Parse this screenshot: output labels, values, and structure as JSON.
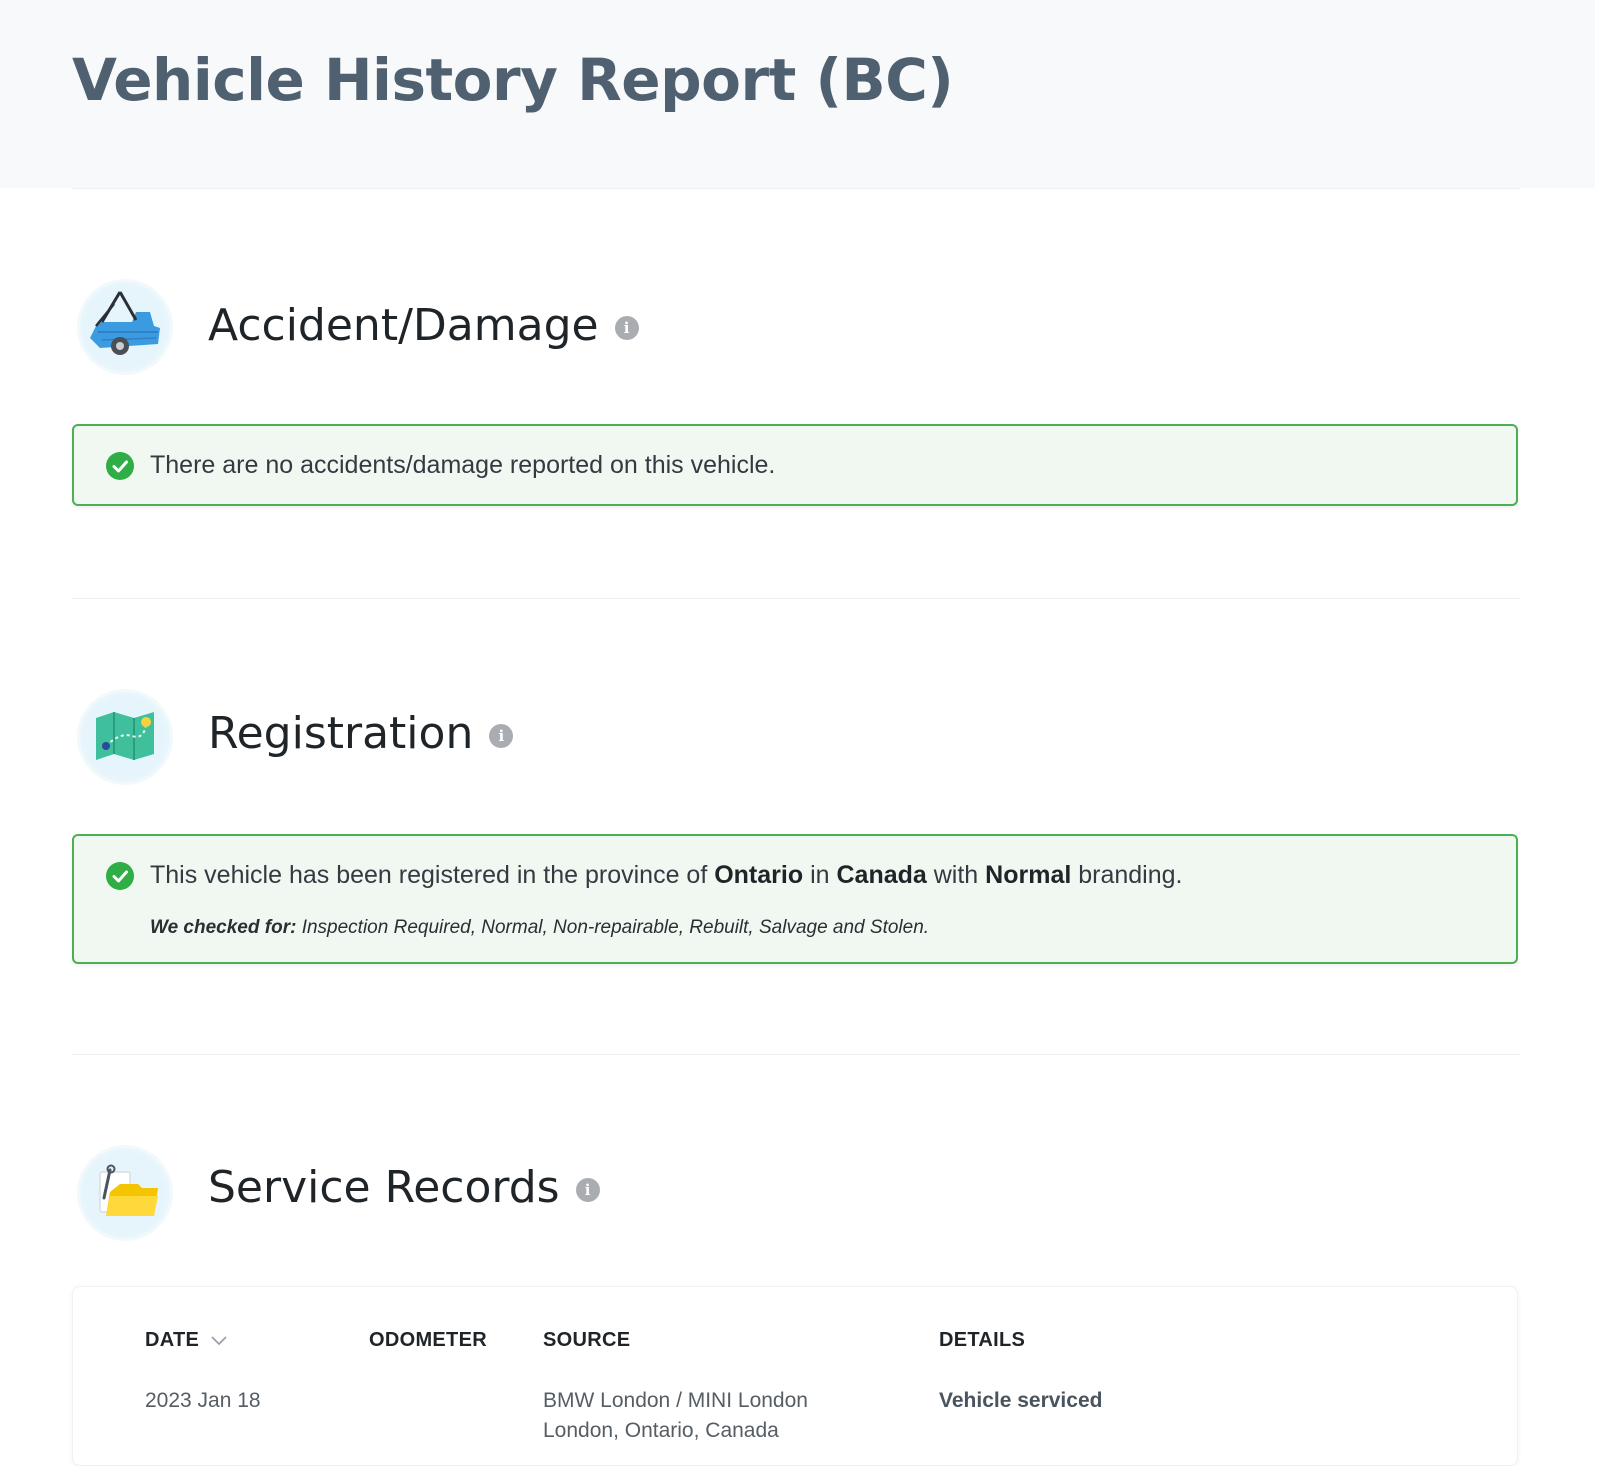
{
  "header": {
    "title": "Vehicle History Report (BC)"
  },
  "sections": {
    "accident": {
      "title": "Accident/Damage",
      "icon": "tow-truck-icon",
      "message": "There are no accidents/damage reported on this vehicle."
    },
    "registration": {
      "title": "Registration",
      "icon": "map-icon",
      "message_prefix": "This vehicle has been registered in the province of ",
      "province": "Ontario",
      "message_mid1": " in ",
      "country": "Canada",
      "message_mid2": " with ",
      "branding": "Normal",
      "message_suffix": " branding.",
      "checked_label": "We checked for:",
      "checked_list": " Inspection Required, Normal, Non-repairable, Rebuilt, Salvage and Stolen."
    },
    "service": {
      "title": "Service Records",
      "icon": "folder-wrench-icon",
      "columns": {
        "date": "DATE",
        "odometer": "ODOMETER",
        "source": "SOURCE",
        "details": "DETAILS"
      },
      "rows": [
        {
          "date": "2023 Jan 18",
          "odometer": "",
          "source_line1": "BMW London / MINI London",
          "source_line2": "London, Ontario, Canada",
          "details": "Vehicle serviced"
        }
      ]
    }
  },
  "colors": {
    "success_border": "#4caf50",
    "success_bg": "#f1f8f1",
    "check": "#2fae46",
    "title": "#4f6070"
  }
}
